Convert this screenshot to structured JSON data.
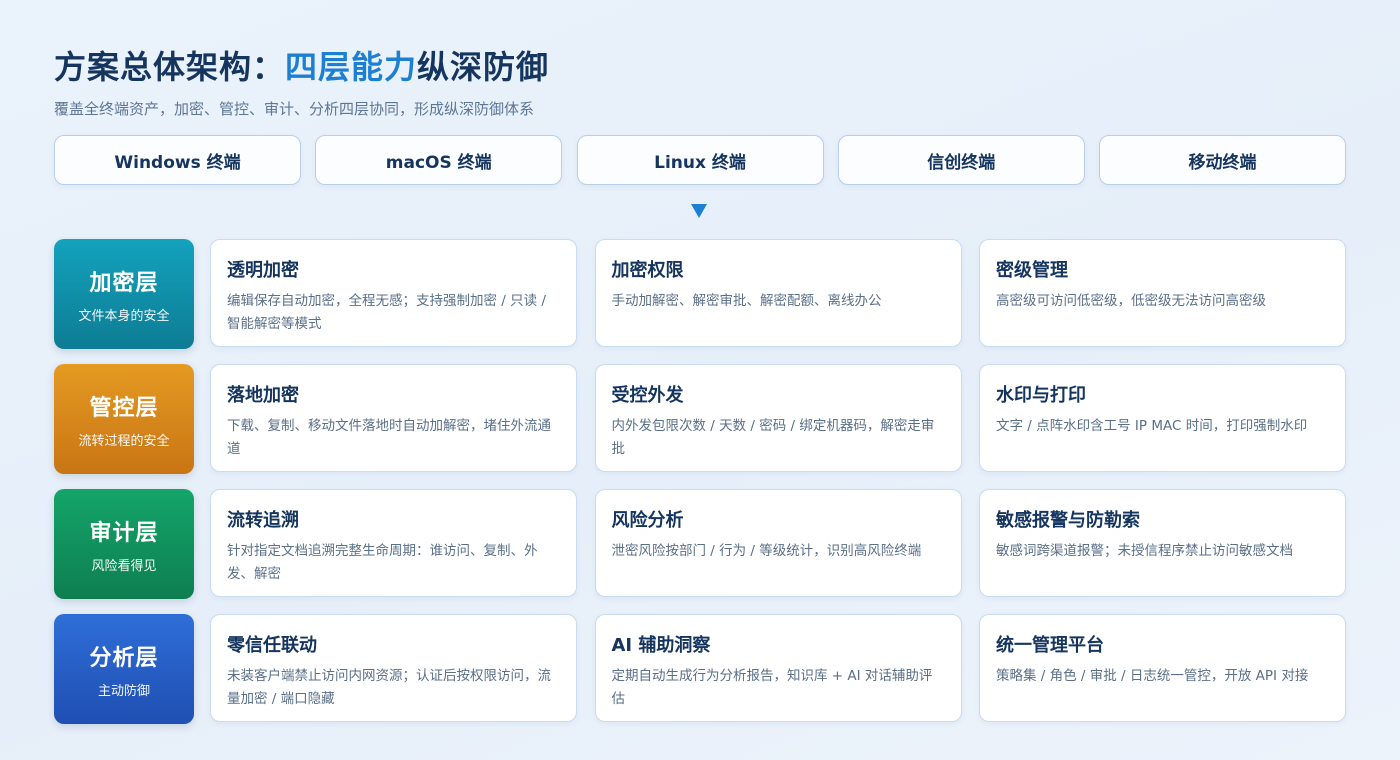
{
  "header": {
    "title_prefix": "方案总体架构：",
    "title_accent": "四层能力",
    "title_suffix": "纵深防御",
    "subtitle": "覆盖全终端资产，加密、管控、审计、分析四层协同，形成纵深防御体系"
  },
  "platforms": [
    "Windows 终端",
    "macOS 终端",
    "Linux 终端",
    "信创终端",
    "移动终端"
  ],
  "colors": {
    "accent": "#1d7fd1",
    "title": "#15355f",
    "encryption_layer": "#13a2bd",
    "control_layer": "#e59a22",
    "audit_layer": "#14a56a",
    "analysis_layer": "#2f6ed8"
  },
  "layers": [
    {
      "name": "加密层",
      "desc": "文件本身的安全",
      "cards": [
        {
          "title": "透明加密",
          "desc": "编辑保存自动加密，全程无感；支持强制加密 / 只读 / 智能解密等模式"
        },
        {
          "title": "加密权限",
          "desc": "手动加解密、解密审批、解密配额、离线办公"
        },
        {
          "title": "密级管理",
          "desc": "高密级可访问低密级，低密级无法访问高密级"
        }
      ]
    },
    {
      "name": "管控层",
      "desc": "流转过程的安全",
      "cards": [
        {
          "title": "落地加密",
          "desc": "下载、复制、移动文件落地时自动加解密，堵住外流通道"
        },
        {
          "title": "受控外发",
          "desc": "内外发包限次数 / 天数 / 密码 / 绑定机器码，解密走审批"
        },
        {
          "title": "水印与打印",
          "desc": "文字 / 点阵水印含工号 IP MAC 时间，打印强制水印"
        }
      ]
    },
    {
      "name": "审计层",
      "desc": "风险看得见",
      "cards": [
        {
          "title": "流转追溯",
          "desc": "针对指定文档追溯完整生命周期：谁访问、复制、外发、解密"
        },
        {
          "title": "风险分析",
          "desc": "泄密风险按部门 / 行为 / 等级统计，识别高风险终端"
        },
        {
          "title": "敏感报警与防勒索",
          "desc": "敏感词跨渠道报警；未授信程序禁止访问敏感文档"
        }
      ]
    },
    {
      "name": "分析层",
      "desc": "主动防御",
      "cards": [
        {
          "title": "零信任联动",
          "desc": "未装客户端禁止访问内网资源；认证后按权限访问，流量加密 / 端口隐藏"
        },
        {
          "title": "AI 辅助洞察",
          "desc": "定期自动生成行为分析报告，知识库 + AI 对话辅助评估"
        },
        {
          "title": "统一管理平台",
          "desc": "策略集 / 角色 / 审批 / 日志统一管控，开放 API 对接"
        }
      ]
    }
  ]
}
